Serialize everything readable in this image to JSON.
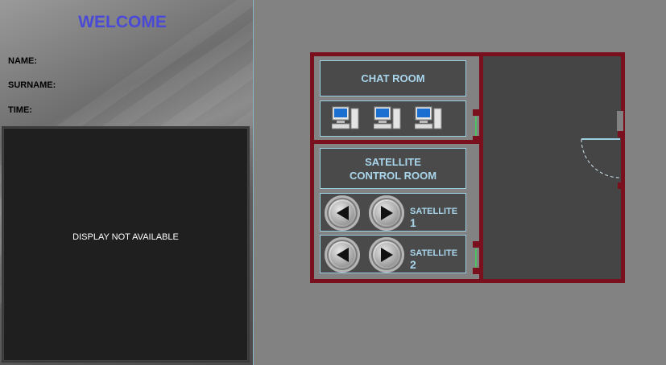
{
  "welcome": {
    "title": "WELCOME"
  },
  "user_info": {
    "name_label": "NAME:",
    "surname_label": "SURNAME:",
    "time_label": "TIME:"
  },
  "display": {
    "message": "DISPLAY NOT AVAILABLE"
  },
  "chat_room": {
    "label": "CHAT ROOM",
    "computers": [
      "computer-icon",
      "computer-icon",
      "computer-icon"
    ]
  },
  "satellite_room": {
    "label_line1": "SATELLITE",
    "label_line2": "CONTROL ROOM",
    "satellites": [
      {
        "label": "SATELLITE",
        "number": "1"
      },
      {
        "label": "SATELLITE",
        "number": "2"
      }
    ]
  },
  "colors": {
    "wall": "#7a0f1e",
    "panel_text": "#a9d6ec",
    "welcome": "#4a4ad6"
  }
}
